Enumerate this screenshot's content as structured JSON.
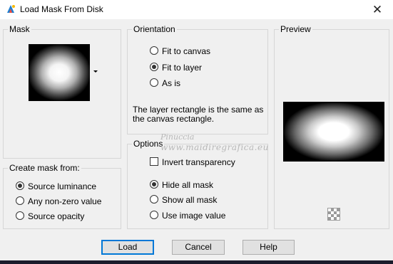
{
  "window": {
    "title": "Load Mask From Disk",
    "close_label": "✕",
    "icon": "psp-app-icon"
  },
  "mask": {
    "label": "Mask"
  },
  "create_mask_from": {
    "label": "Create mask from:",
    "options": [
      {
        "label": "Source luminance",
        "checked": true
      },
      {
        "label": "Any non-zero value",
        "checked": false
      },
      {
        "label": "Source opacity",
        "checked": false
      }
    ]
  },
  "orientation": {
    "label": "Orientation",
    "options": [
      {
        "label": "Fit to canvas",
        "checked": false
      },
      {
        "label": "Fit to layer",
        "checked": true
      },
      {
        "label": "As is",
        "checked": false
      }
    ],
    "info_text": "The layer rectangle is the same as the canvas rectangle."
  },
  "options": {
    "label": "Options",
    "invert_transparency": {
      "label": "Invert transparency",
      "checked": false
    },
    "radios": [
      {
        "label": "Hide all mask",
        "checked": true
      },
      {
        "label": "Show all mask",
        "checked": false
      },
      {
        "label": "Use image value",
        "checked": false
      }
    ]
  },
  "preview": {
    "label": "Preview",
    "transparency_icon": "checkerboard-icon"
  },
  "buttons": {
    "load": "Load",
    "cancel": "Cancel",
    "help": "Help"
  },
  "watermark": {
    "line1": "Pinuccia",
    "line2": "www.maidiregrafica.eu"
  },
  "colors": {
    "background": "#f0f0f0",
    "default_button_border": "#0078d7",
    "group_border": "#d6d6d6"
  }
}
